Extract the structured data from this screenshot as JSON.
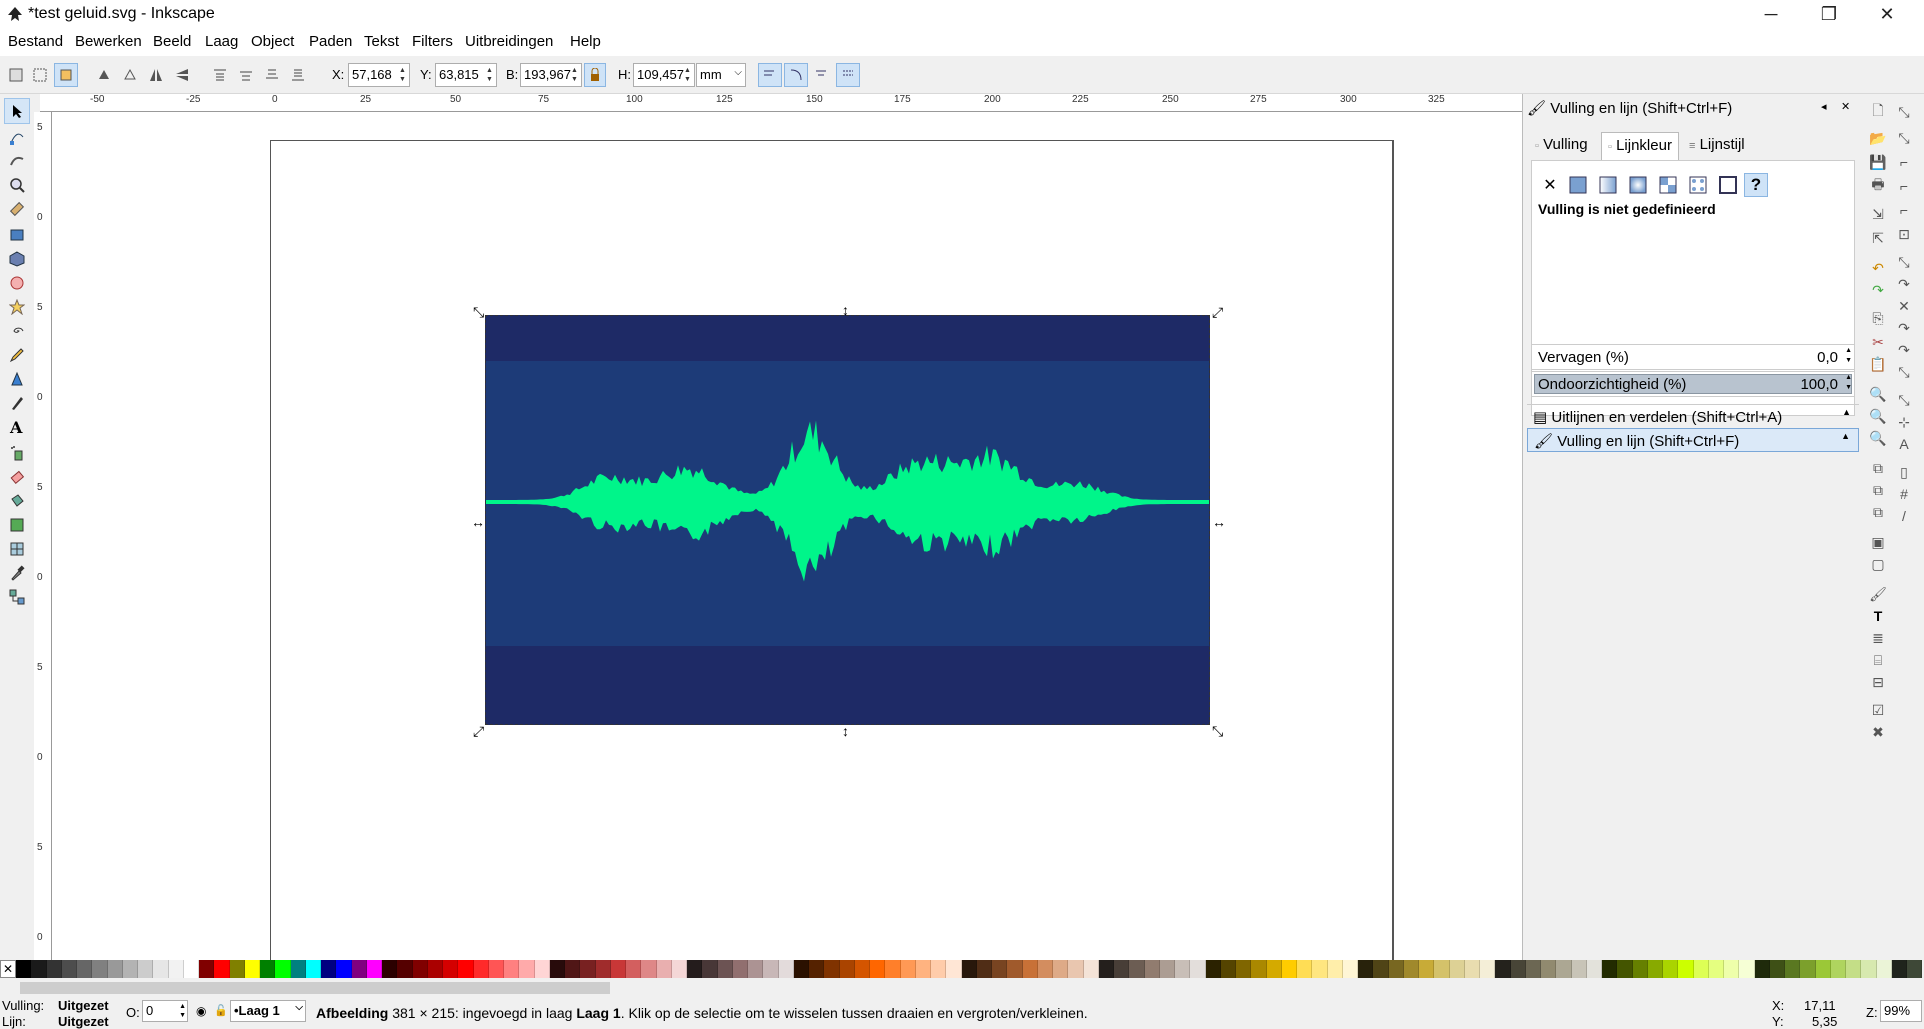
{
  "window": {
    "title": "*test geluid.svg - Inkscape",
    "minimize": "─",
    "maximize": "❐",
    "close": "✕"
  },
  "menu": [
    "Bestand",
    "Bewerken",
    "Beeld",
    "Laag",
    "Object",
    "Paden",
    "Tekst",
    "Filters",
    "Uitbreidingen",
    "Help"
  ],
  "toolbar": {
    "x_label": "X:",
    "x_value": "57,168",
    "y_label": "Y:",
    "y_value": "63,815",
    "w_label": "B:",
    "w_value": "193,967",
    "h_label": "H:",
    "h_value": "109,457",
    "unit": "mm"
  },
  "ruler": {
    "h_ticks": [
      "-50",
      "-25",
      "0",
      "25",
      "50",
      "75",
      "100",
      "125",
      "150",
      "175",
      "200",
      "225",
      "250",
      "275",
      "300",
      "325"
    ],
    "v_ticks": [
      "5",
      "0",
      "5",
      "0",
      "5",
      "0",
      "5",
      "0",
      "5",
      "0",
      "5",
      "0",
      "5"
    ]
  },
  "dock": {
    "title": "Vulling en lijn (Shift+Ctrl+F)",
    "tabs": [
      "Vulling",
      "Lijnkleur",
      "Lijnstijl"
    ],
    "paint_message": "Vulling is niet gedefinieerd",
    "blur_label": "Vervagen (%)",
    "blur_value": "0,0",
    "opacity_label": "Ondoorzichtigheid (%)",
    "opacity_value": "100,0",
    "opacity_level": 1.0,
    "collapsed_panel": "Uitlijnen en verdelen (Shift+Ctrl+A)",
    "active_panel": "Vulling en lijn (Shift+Ctrl+F)"
  },
  "status": {
    "fill_label": "Vulling:",
    "fill_value": "Uitgezet",
    "stroke_label": "Lijn:",
    "stroke_value": "Uitgezet",
    "opacity_label": "O:",
    "opacity_value": "0",
    "layer": "•Laag 1",
    "message_bold": "Afbeelding",
    "message": "381 × 215: ingevoegd in laag",
    "message_layer": "Laag 1",
    "message_tail": ". Klik op de selectie om te wisselen tussen draaien en vergroten/verkleinen.",
    "cursor_x_label": "X:",
    "cursor_x": "17,11",
    "cursor_y_label": "Y:",
    "cursor_y": "5,35",
    "zoom_label": "Z:",
    "zoom": "99%"
  },
  "colors": {
    "image_bg_dark": "#1e2a66",
    "image_band": "#1d3b78",
    "waveform": "#00f58a",
    "accent_selected": "#cfe3f7"
  },
  "palette": [
    "#000000",
    "#1a1a1a",
    "#333333",
    "#4d4d4d",
    "#666666",
    "#808080",
    "#999999",
    "#b3b3b3",
    "#cccccc",
    "#e6e6e6",
    "#f2f2f2",
    "#ffffff",
    "#800000",
    "#ff0000",
    "#808000",
    "#ffff00",
    "#008000",
    "#00ff00",
    "#008080",
    "#00ffff",
    "#000080",
    "#0000ff",
    "#800080",
    "#ff00ff",
    "#2b0000",
    "#550000",
    "#800000",
    "#aa0000",
    "#d40000",
    "#ff0000",
    "#ff2a2a",
    "#ff5555",
    "#ff8080",
    "#ffaaaa",
    "#ffd5d5",
    "#280b0b",
    "#501616",
    "#782121",
    "#a02c2c",
    "#c83737",
    "#d35f5f",
    "#de8787",
    "#e9afaf",
    "#f4d7d7",
    "#241c1c",
    "#483737",
    "#6c5353",
    "#916f6f",
    "#ac9393",
    "#c8b7b7",
    "#e3dbdb",
    "#2b1100",
    "#552200",
    "#803300",
    "#aa4400",
    "#d45500",
    "#ff6600",
    "#ff7f2a",
    "#ff9955",
    "#ffb380",
    "#ffccaa",
    "#ffe6d5",
    "#28170b",
    "#502d16",
    "#784421",
    "#a05a2c",
    "#c87137",
    "#d38d5f",
    "#deaa87",
    "#e9c6af",
    "#f4e3d7",
    "#241f1c",
    "#483e37",
    "#6c5d53",
    "#917c6f",
    "#ac9d93",
    "#c8beb7",
    "#e3dedb",
    "#2b2200",
    "#554400",
    "#806600",
    "#aa8800",
    "#d4aa00",
    "#ffcc00",
    "#ffdd55",
    "#ffe680",
    "#ffeeaa",
    "#fff6d5",
    "#28220b",
    "#504416",
    "#786721",
    "#a0892c",
    "#c8ab37",
    "#d4c26a",
    "#ddd195",
    "#e9ddaf",
    "#f4eed7",
    "#24221c",
    "#484537",
    "#6c6753",
    "#918a6f",
    "#aca793",
    "#c8c4b7",
    "#e3e2db",
    "#222b00",
    "#445500",
    "#668000",
    "#88aa00",
    "#aad400",
    "#ccff00",
    "#ddff55",
    "#e5ff80",
    "#eeffaa",
    "#f6ffd5",
    "#1f2a0b",
    "#3e5016",
    "#5a7821",
    "#7ca02c",
    "#9bc837",
    "#afd45f",
    "#c4de87",
    "#d7e9af",
    "#ebf4d7",
    "#1f241c",
    "#3e4837"
  ]
}
